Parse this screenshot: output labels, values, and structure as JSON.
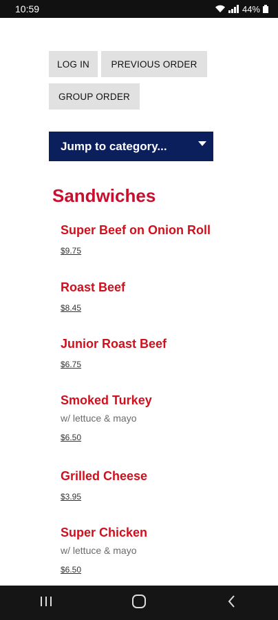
{
  "status": {
    "time": "10:59",
    "battery": "44%"
  },
  "buttons": {
    "login": "LOG IN",
    "previous_order": "PREVIOUS ORDER",
    "group_order": "GROUP ORDER"
  },
  "jump": {
    "label": "Jump to category..."
  },
  "category": {
    "title": "Sandwiches"
  },
  "items": [
    {
      "name": "Super Beef on Onion Roll",
      "desc": "",
      "price": "$9.75"
    },
    {
      "name": "Roast Beef",
      "desc": "",
      "price": "$8.45"
    },
    {
      "name": "Junior Roast Beef",
      "desc": "",
      "price": "$6.75"
    },
    {
      "name": "Smoked Turkey",
      "desc": "w/ lettuce & mayo",
      "price": "$6.50"
    },
    {
      "name": "Grilled Cheese",
      "desc": "",
      "price": "$3.95"
    },
    {
      "name": "Super Chicken",
      "desc": "w/ lettuce & mayo",
      "price": "$6.50"
    }
  ],
  "nav": {
    "recents_icon": "recents-icon",
    "home_icon": "home-icon",
    "back_icon": "back-icon"
  },
  "colors": {
    "accent_red": "#d0101c",
    "navy": "#0b1f5c"
  }
}
